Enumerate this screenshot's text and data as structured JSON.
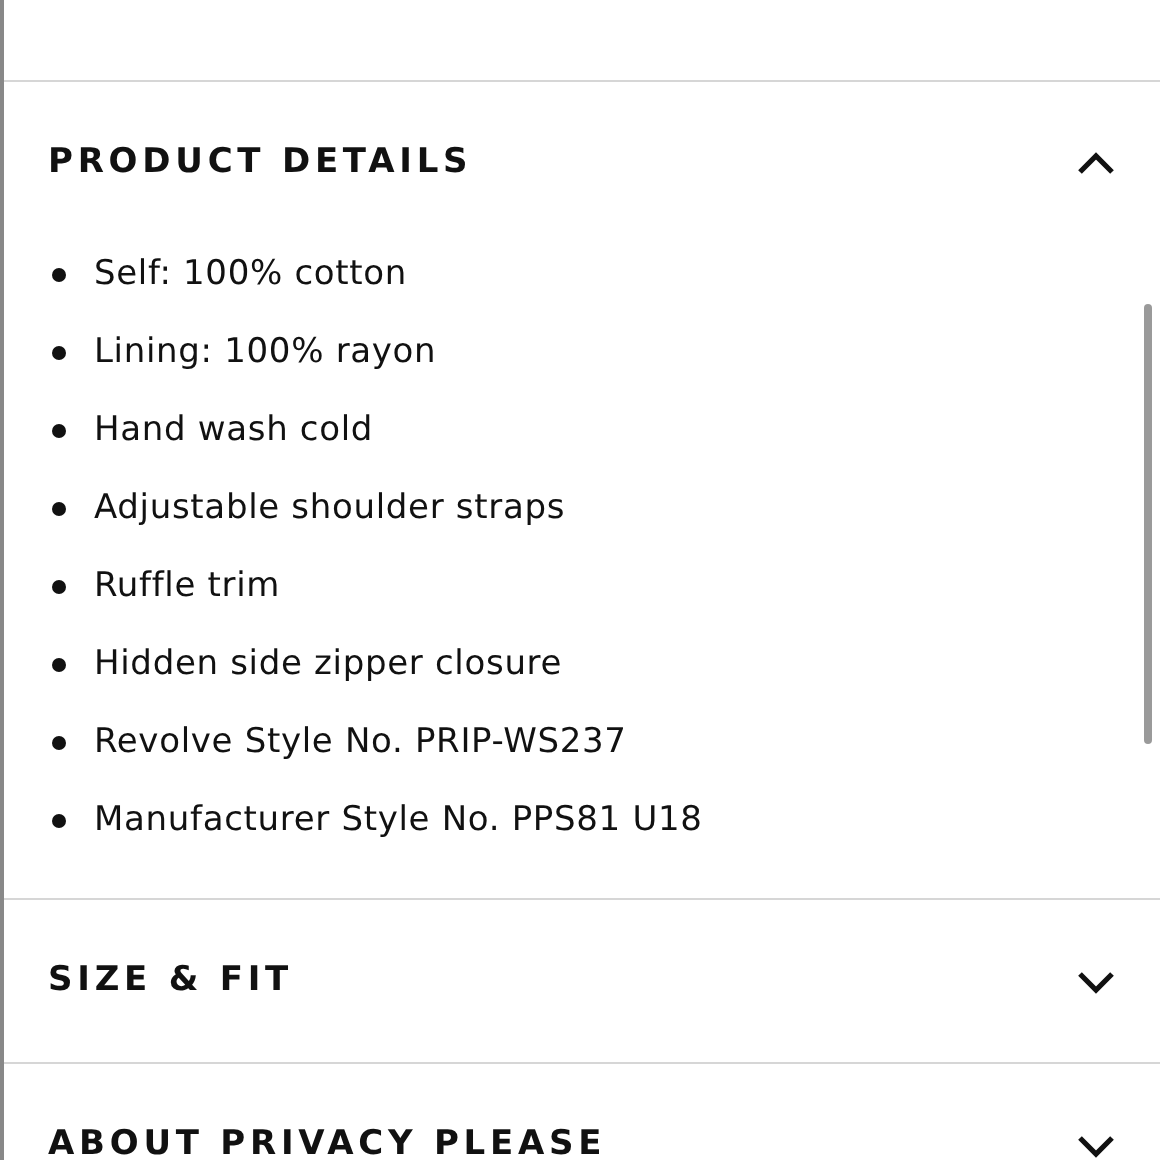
{
  "sections": [
    {
      "title": "PRODUCT DETAILS",
      "expanded": true,
      "items": [
        "Self: 100% cotton",
        "Lining: 100% rayon",
        "Hand wash cold",
        "Adjustable shoulder straps",
        "Ruffle trim",
        "Hidden side zipper closure",
        "Revolve Style No. PRIP-WS237",
        "Manufacturer Style No. PPS81 U18"
      ]
    },
    {
      "title": "SIZE & FIT",
      "expanded": false
    },
    {
      "title": "ABOUT PRIVACY PLEASE",
      "expanded": false
    }
  ]
}
